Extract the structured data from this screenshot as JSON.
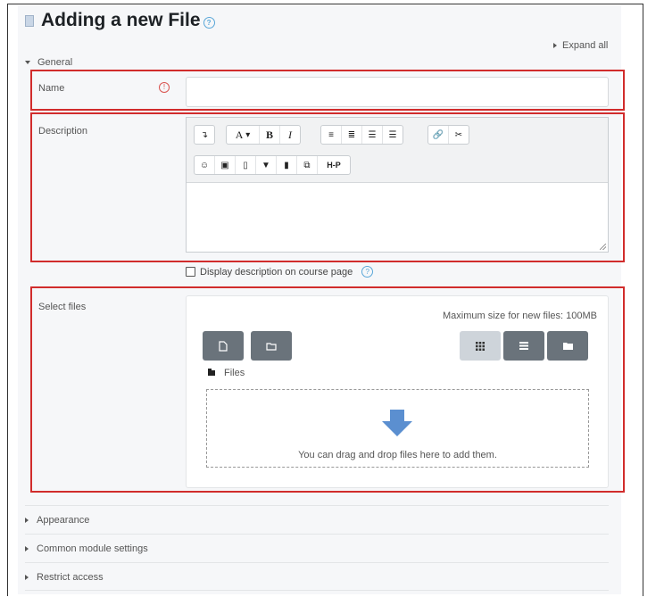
{
  "page": {
    "title": "Adding a new File",
    "expand_all": "Expand all"
  },
  "general": {
    "legend": "General",
    "name_label": "Name",
    "name_value": "",
    "description_label": "Description",
    "display_description": "Display description on course page",
    "select_files_label": "Select files"
  },
  "editor": {
    "row1": [
      "undo",
      "font",
      "bold",
      "italic",
      "bullet-list",
      "numbered-list",
      "outdent",
      "indent",
      "link",
      "unlink"
    ],
    "row2": [
      "emoji",
      "image",
      "media",
      "record-audio",
      "record-video",
      "manage-files",
      "h5p"
    ],
    "font_label": "A",
    "bold_label": "B",
    "italic_label": "I",
    "h5p_label": "H-P"
  },
  "filepicker": {
    "max_size": "Maximum size for new files: 100MB",
    "files_label": "Files",
    "drop_text": "You can drag and drop files here to add them.",
    "view_mode": "icons"
  },
  "sections": [
    {
      "label": "Appearance"
    },
    {
      "label": "Common module settings"
    },
    {
      "label": "Restrict access"
    }
  ],
  "colors": {
    "highlight": "#d12c2c",
    "button": "#6a737b",
    "help": "#5aa7d8",
    "drop_arrow": "#5b8fd0"
  }
}
